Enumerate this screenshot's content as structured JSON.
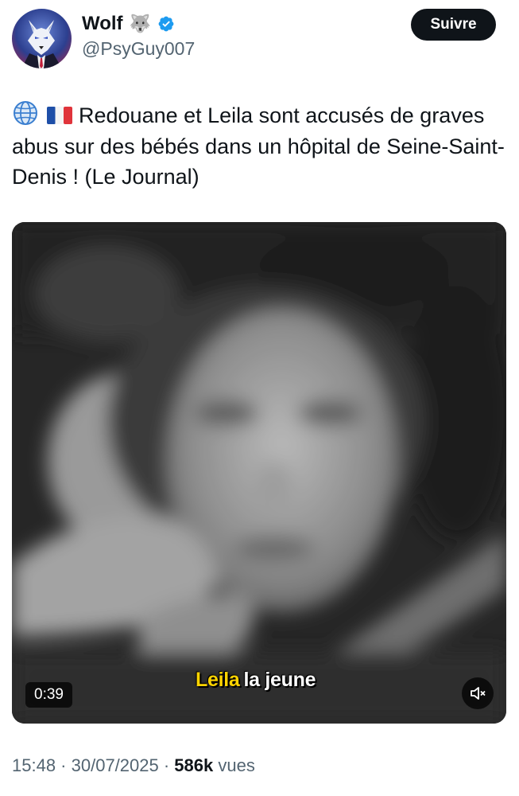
{
  "author": {
    "display_name": "Wolf",
    "name_emoji": "🐺",
    "verified_icon": "verified-badge-icon",
    "handle": "@PsyGuy007",
    "avatar_icon": "wolf-in-suit-avatar"
  },
  "follow_button": {
    "label": "Suivre"
  },
  "tweet": {
    "prefix_icons": [
      "globe-icon",
      "france-flag-icon"
    ],
    "text": "Redouane et Leila sont accusés de graves abus sur des bébés dans un hôpital de Seine-Saint-Denis ! (Le Journal)"
  },
  "media": {
    "caption_name": "Leila",
    "caption_rest": "la jeune",
    "duration": "0:39",
    "mute_icon": "muted-speaker-icon"
  },
  "meta": {
    "time": "15:48",
    "sep1": " · ",
    "date": "30/07/2025",
    "sep2": " · ",
    "views_count": "586k",
    "views_label": " vues"
  },
  "colors": {
    "text_primary": "#0f1419",
    "text_secondary": "#536471",
    "verified_blue": "#1d9bf0",
    "button_bg": "#0f1419",
    "caption_highlight": "#ffd400"
  }
}
